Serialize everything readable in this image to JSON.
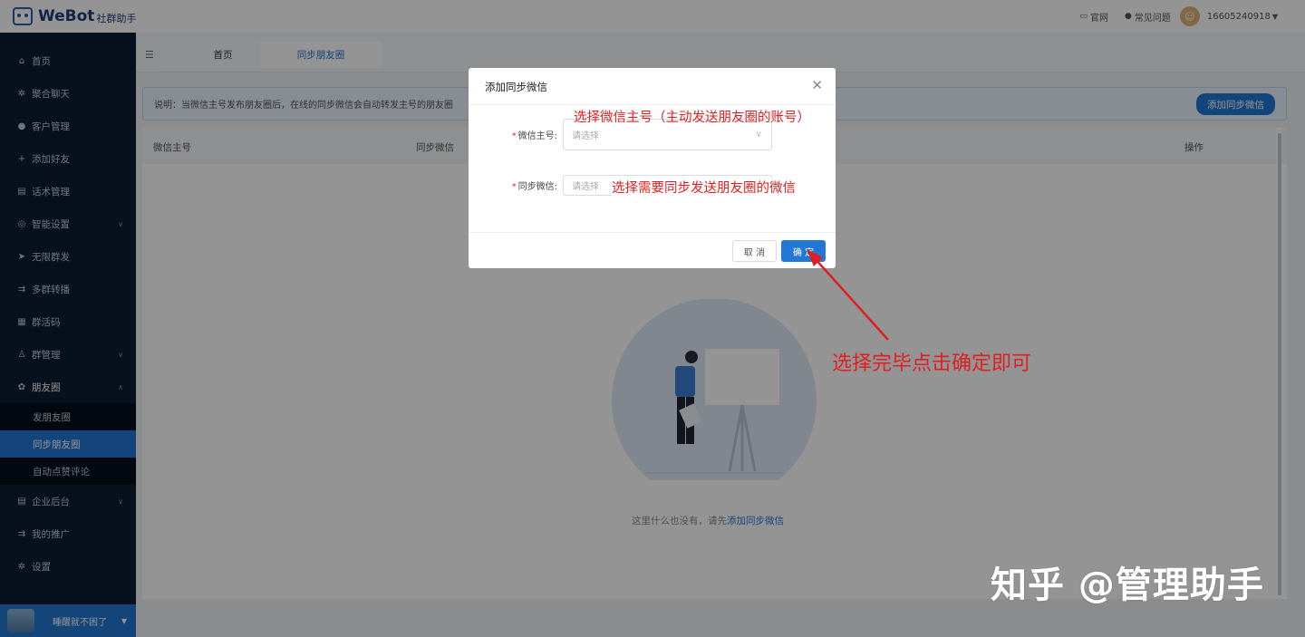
{
  "header": {
    "logo_text": "WeBot",
    "logo_sub": "社群助手",
    "links": [
      {
        "icon": "monitor-icon",
        "label": "官网"
      },
      {
        "icon": "help-circle-icon",
        "label": "常见问题"
      }
    ],
    "user": "16605240918"
  },
  "sidebar": {
    "items": [
      {
        "icon": "home-icon",
        "label": "首页"
      },
      {
        "icon": "gear-icon",
        "label": "聚合聊天"
      },
      {
        "icon": "user-icon",
        "label": "客户管理"
      },
      {
        "icon": "add-user-icon",
        "label": "添加好友"
      },
      {
        "icon": "document-icon",
        "label": "话术管理"
      },
      {
        "icon": "smart-icon",
        "label": "智能设置"
      },
      {
        "icon": "send-icon",
        "label": "无限群发"
      },
      {
        "icon": "forward-icon",
        "label": "多群转播"
      },
      {
        "icon": "qrcode-icon",
        "label": "群活码"
      },
      {
        "icon": "group-icon",
        "label": "群管理"
      },
      {
        "icon": "moments-icon",
        "label": "朋友圈"
      },
      {
        "icon": "enterprise-icon",
        "label": "企业后台"
      },
      {
        "icon": "promotion-icon",
        "label": "我的推广"
      },
      {
        "icon": "settings-icon",
        "label": "设置"
      }
    ],
    "sub_items": [
      "发朋友圈",
      "同步朋友圈",
      "自动点赞评论"
    ],
    "footer_name": "睡醒就不困了"
  },
  "tabs": [
    "首页",
    "同步朋友圈"
  ],
  "notice": {
    "text": "说明：当微信主号发布朋友圈后，在线的同步微信会自动转发主号的朋友圈",
    "button": "添加同步微信"
  },
  "table": {
    "columns": [
      "微信主号",
      "同步微信",
      "操作"
    ],
    "empty_text": "这里什么也没有，请先",
    "empty_link": "添加同步微信"
  },
  "dialog": {
    "title": "添加同步微信",
    "fields": [
      {
        "label": "微信主号:",
        "placeholder": "请选择"
      },
      {
        "label": "同步微信:",
        "placeholder": "请选择"
      }
    ],
    "cancel": "取 消",
    "confirm": "确 定"
  },
  "annotations": {
    "a1": "选择微信主号（主动发送朋友圈的账号）",
    "a2": "选择需要同步发送朋友圈的微信",
    "a3": "选择完毕点击确定即可"
  },
  "watermark": "知乎 @管理助手",
  "colors": {
    "accent": "#2278d4",
    "sidebar": "#0d1c33",
    "annotation": "#e02020"
  }
}
